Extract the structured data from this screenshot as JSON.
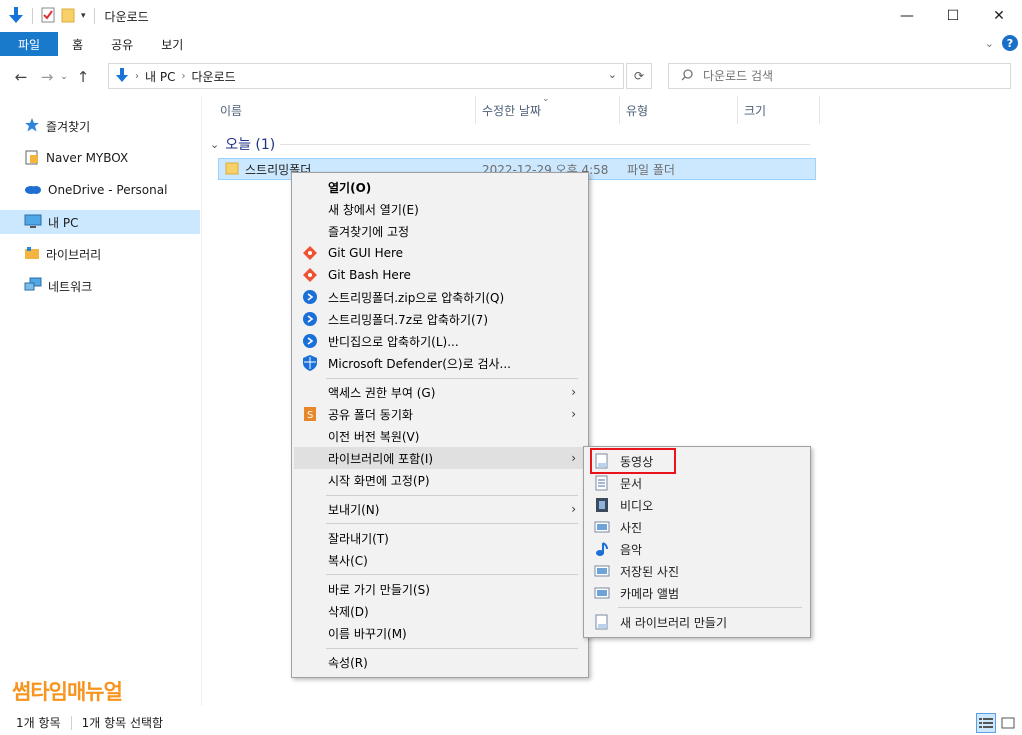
{
  "window": {
    "title": "다운로드",
    "controls": {
      "minimize": "—",
      "maximize": "☐",
      "close": "✕"
    }
  },
  "ribbon": {
    "tabs": [
      "파일",
      "홈",
      "공유",
      "보기"
    ],
    "help": "?"
  },
  "address": {
    "segments": [
      "내 PC",
      "다운로드"
    ],
    "search_placeholder": "다운로드 검색"
  },
  "sidebar": {
    "items": [
      {
        "label": "즐겨찾기",
        "icon": "star-icon"
      },
      {
        "label": "Naver MYBOX",
        "icon": "cloud-box-icon"
      },
      {
        "label": "OneDrive - Personal",
        "icon": "onedrive-icon"
      },
      {
        "label": "내 PC",
        "icon": "pc-icon",
        "selected": true
      },
      {
        "label": "라이브러리",
        "icon": "library-icon"
      },
      {
        "label": "네트워크",
        "icon": "network-icon"
      }
    ]
  },
  "columns": [
    "이름",
    "수정한 날짜",
    "유형",
    "크기"
  ],
  "group": {
    "label": "오늘 (1)"
  },
  "file": {
    "name": "스트리밍폴더",
    "date": "2022-12-29 오후 4:58",
    "type": "파일 폴더"
  },
  "context_menu": {
    "items": [
      {
        "label": "열기(O)",
        "bold": true
      },
      {
        "label": "새 창에서 열기(E)"
      },
      {
        "label": "즐겨찾기에 고정"
      },
      {
        "label": "Git GUI Here",
        "icon": "git-icon"
      },
      {
        "label": "Git Bash Here",
        "icon": "git-icon"
      },
      {
        "label": "스트리밍폴더.zip으로 압축하기(Q)",
        "icon": "bandizip-icon"
      },
      {
        "label": "스트리밍폴더.7z로 압축하기(7)",
        "icon": "bandizip-icon"
      },
      {
        "label": "반디집으로 압축하기(L)...",
        "icon": "bandizip-icon"
      },
      {
        "label": "Microsoft Defender(으)로 검사...",
        "icon": "defender-shield-icon"
      },
      {
        "label": "액세스 권한 부여 (G)",
        "submenu": true
      },
      {
        "label": "공유 폴더 동기화",
        "icon": "sync-folder-icon",
        "submenu": true
      },
      {
        "label": "이전 버전 복원(V)"
      },
      {
        "label": "라이브러리에 포함(I)",
        "submenu": true,
        "highlighted": true
      },
      {
        "label": "시작 화면에 고정(P)"
      },
      {
        "label": "보내기(N)",
        "submenu": true
      },
      {
        "label": "잘라내기(T)"
      },
      {
        "label": "복사(C)"
      },
      {
        "label": "바로 가기 만들기(S)"
      },
      {
        "label": "삭제(D)"
      },
      {
        "label": "이름 바꾸기(M)"
      },
      {
        "label": "속성(R)"
      }
    ]
  },
  "submenu": {
    "items": [
      {
        "label": "동영상",
        "icon": "library-doc-icon"
      },
      {
        "label": "문서",
        "icon": "documents-icon"
      },
      {
        "label": "비디오",
        "icon": "video-icon"
      },
      {
        "label": "사진",
        "icon": "pictures-icon"
      },
      {
        "label": "음악",
        "icon": "music-icon"
      },
      {
        "label": "저장된 사진",
        "icon": "pictures-icon"
      },
      {
        "label": "카메라 앨범",
        "icon": "pictures-icon"
      },
      {
        "label": "새 라이브러리 만들기",
        "icon": "library-doc-icon"
      }
    ]
  },
  "status": {
    "count": "1개 항목",
    "selected": "1개 항목 선택함"
  },
  "watermark": "썸타임매뉴얼",
  "colors": {
    "accent": "#1979ca",
    "selection": "#cce8ff",
    "highlight_box": "#e8141a",
    "watermark": "#f7941d"
  }
}
